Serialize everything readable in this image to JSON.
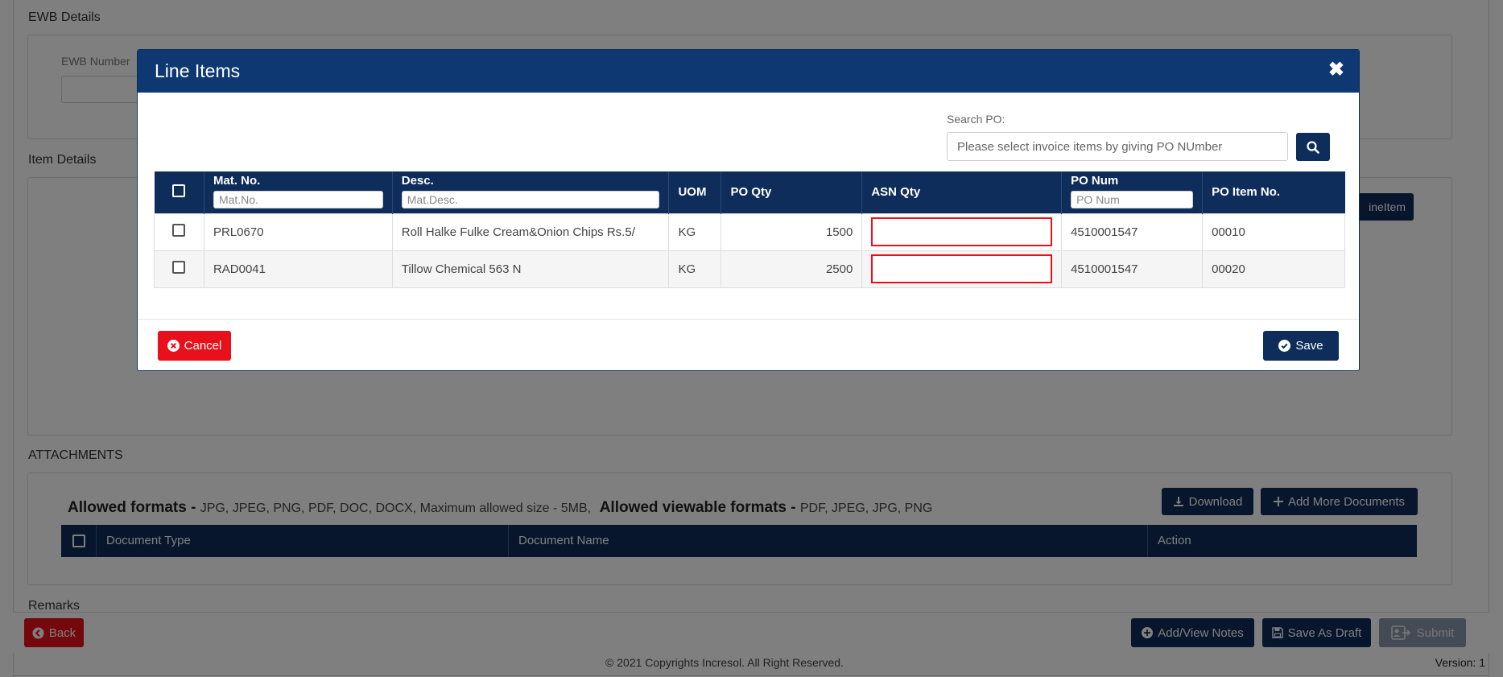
{
  "background": {
    "ewb_section_title": "EWB Details",
    "ewb_number_label": "EWB Number",
    "item_section_title": "Item Details",
    "add_line_item_partial": "ineItem",
    "attachments_title": "ATTACHMENTS",
    "allowed_formats_label": "Allowed formats -",
    "allowed_formats_value": "JPG, JPEG, PNG, PDF, DOC, DOCX, Maximum allowed size - 5MB,",
    "allowed_viewable_label": "Allowed viewable formats -",
    "allowed_viewable_value": "PDF, JPEG, JPG, PNG",
    "download_label": "Download",
    "add_more_documents_label": "Add More Documents",
    "doc_table_headers": [
      "Document Type",
      "Document Name",
      "Action"
    ],
    "remarks_label": "Remarks",
    "back_label": "Back",
    "add_view_notes_label": "Add/View Notes",
    "save_as_draft_label": "Save As Draft",
    "submit_label": "Submit",
    "copyright": "© 2021 Copyrights Incresol. All Right Reserved.",
    "version": "Version: 1"
  },
  "modal": {
    "title": "Line Items",
    "close_glyph": "✖",
    "search_label": "Search PO:",
    "search_placeholder": "Please select invoice items by giving PO NUmber",
    "columns": {
      "mat_no": "Mat. No.",
      "mat_no_filter_placeholder": "Mat.No.",
      "desc": "Desc.",
      "desc_filter_placeholder": "Mat.Desc.",
      "uom": "UOM",
      "po_qty": "PO Qty",
      "asn_qty": "ASN Qty",
      "po_num": "PO Num",
      "po_num_filter_placeholder": "PO Num",
      "po_item_no": "PO Item No."
    },
    "rows": [
      {
        "mat_no": "PRL0670",
        "desc": "Roll Halke Fulke Cream&Onion Chips Rs.5/",
        "uom": "KG",
        "po_qty": "1500",
        "asn_qty": "",
        "po_num": "4510001547",
        "po_item_no": "00010"
      },
      {
        "mat_no": "RAD0041",
        "desc": "Tillow Chemical 563 N",
        "uom": "KG",
        "po_qty": "2500",
        "asn_qty": "",
        "po_num": "4510001547",
        "po_item_no": "00020"
      }
    ],
    "cancel_label": "Cancel",
    "save_label": "Save"
  },
  "colors": {
    "navy": "#0e2d5a",
    "header_blue": "#0e3872",
    "danger_red": "#e8101a"
  }
}
